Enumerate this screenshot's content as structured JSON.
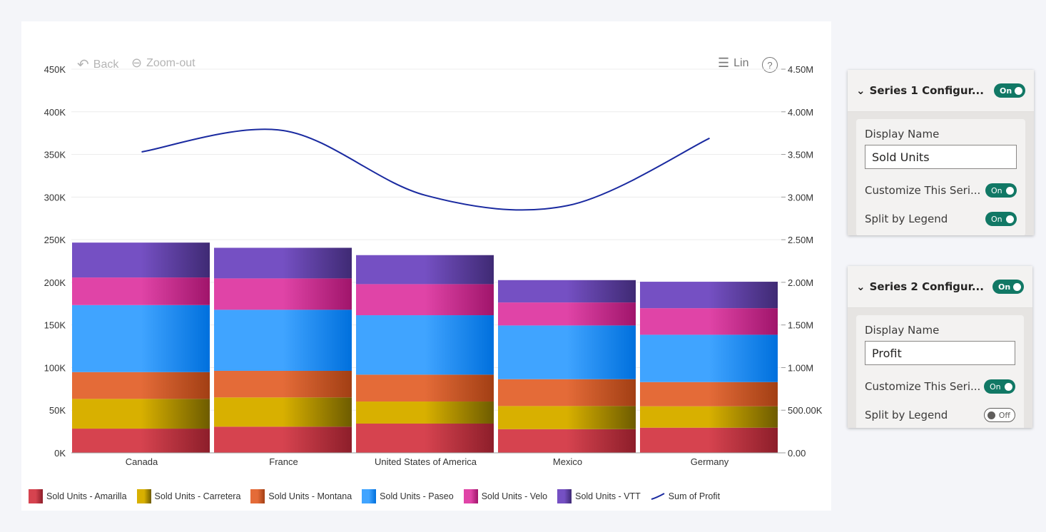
{
  "toolbar": {
    "back": "Back",
    "zoom_out": "Zoom-out",
    "scale": "Lin",
    "help": "?"
  },
  "chart_data": {
    "type": "bar",
    "stacked": true,
    "categories": [
      "Canada",
      "France",
      "United States of America",
      "Mexico",
      "Germany"
    ],
    "series": [
      {
        "name": "Sold Units - Amarilla",
        "color": "#d6434f",
        "dark": "#8d1e2a",
        "values": [
          28400,
          30700,
          34300,
          27800,
          29500
        ]
      },
      {
        "name": "Sold Units - Carretera",
        "color": "#d8b000",
        "dark": "#6e5c00",
        "values": [
          34900,
          34300,
          25900,
          27100,
          25100
        ]
      },
      {
        "name": "Sold Units - Montana",
        "color": "#e46b38",
        "dark": "#a23f14",
        "values": [
          31400,
          31200,
          31500,
          31500,
          28400
        ]
      },
      {
        "name": "Sold Units - Paseo",
        "color": "#40a4ff",
        "dark": "#0070dd",
        "values": [
          78600,
          71600,
          69700,
          63000,
          55500
        ]
      },
      {
        "name": "Sold Units - Velo",
        "color": "#e044a7",
        "dark": "#a0156b",
        "values": [
          32400,
          36800,
          36500,
          27000,
          31200
        ]
      },
      {
        "name": "Sold Units - VTT",
        "color": "#7550c3",
        "dark": "#3f2a74",
        "values": [
          40900,
          35900,
          34000,
          26200,
          31000
        ]
      }
    ],
    "line_series": {
      "name": "Sum of Profit",
      "color": "#1a2aa0",
      "axis": "right",
      "values": [
        3530000,
        3780000,
        3020000,
        2900000,
        3690000
      ]
    },
    "y_left": {
      "range": [
        0,
        450000
      ],
      "ticks": [
        "0K",
        "50K",
        "100K",
        "150K",
        "200K",
        "250K",
        "300K",
        "350K",
        "400K",
        "450K"
      ]
    },
    "y_right": {
      "range": [
        0,
        4500000
      ],
      "ticks": [
        "0.00",
        "500.00K",
        "1.00M",
        "1.50M",
        "2.00M",
        "2.50M",
        "3.00M",
        "3.50M",
        "4.00M",
        "4.50M"
      ]
    },
    "grid": true,
    "legend_position": "bottom-left"
  },
  "panels": [
    {
      "title": "Series 1 Configur...",
      "toggle": "On",
      "display_name_label": "Display Name",
      "display_name": "Sold Units",
      "customize_label": "Customize This Seri...",
      "customize": "On",
      "split_label": "Split by Legend",
      "split": "On"
    },
    {
      "title": "Series 2 Configur...",
      "toggle": "On",
      "display_name_label": "Display Name",
      "display_name": "Profit",
      "customize_label": "Customize This Seri...",
      "customize": "On",
      "split_label": "Split by Legend",
      "split": "Off"
    }
  ]
}
